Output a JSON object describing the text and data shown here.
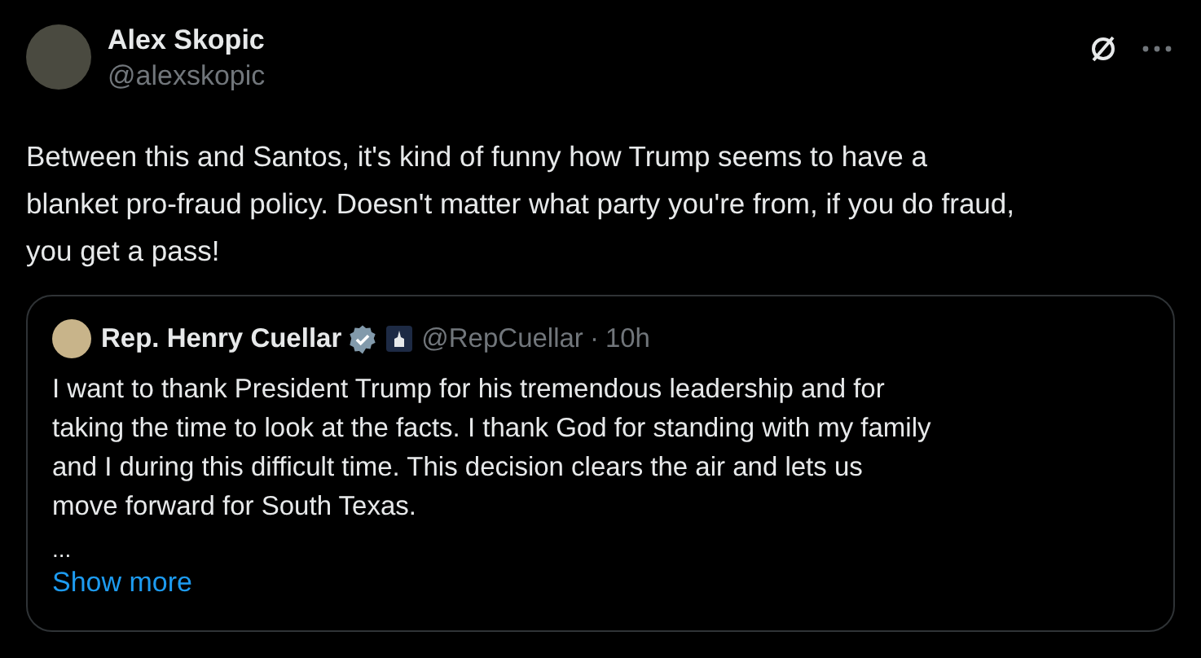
{
  "author": {
    "name": "Alex Skopic",
    "handle": "@alexskopic"
  },
  "body": "Between this and Santos, it's kind of funny how Trump seems to have a blanket pro-fraud policy. Doesn't matter what party you're from, if you do fraud, you get a pass!",
  "quote": {
    "name": "Rep. Henry Cuellar",
    "verified": true,
    "handle": "@RepCuellar",
    "separator": "·",
    "time": "10h",
    "text": "I want to thank President Trump for his tremendous leadership and for taking the time to look at the facts. I thank God for standing with my family and I during this difficult time. This decision clears the air and lets us move forward for South Texas.",
    "ellipsis": "...",
    "show_more": "Show more"
  }
}
